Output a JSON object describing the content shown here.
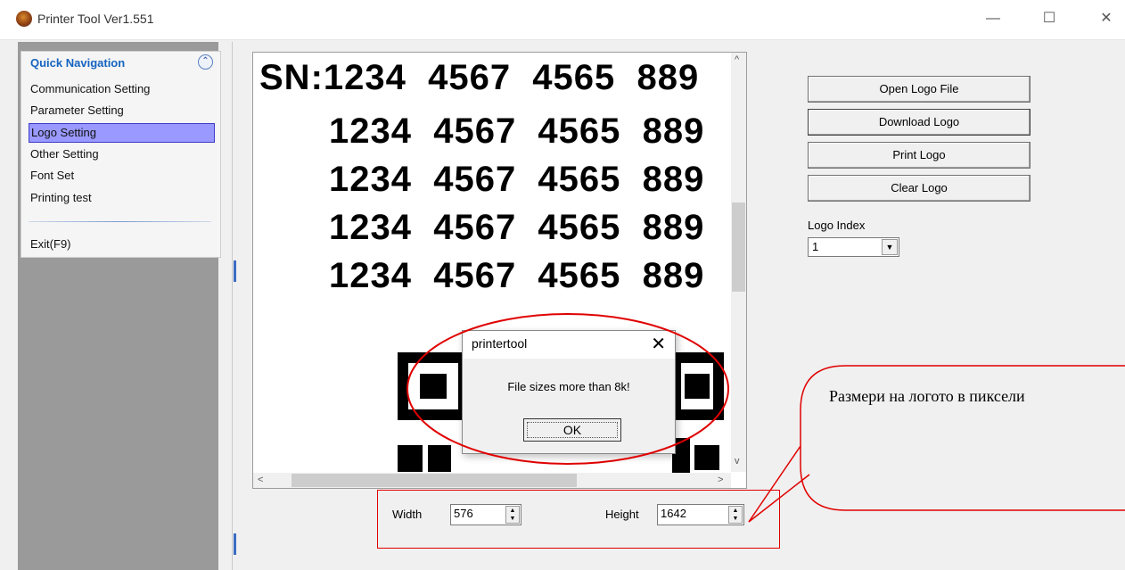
{
  "window": {
    "title": "Printer Tool Ver1.551",
    "minimize": "—",
    "maximize": "☐",
    "close": "✕"
  },
  "nav": {
    "header": "Quick Navigation",
    "collapse": "⌃",
    "items": [
      "Communication Setting",
      "Parameter Setting",
      "Logo Setting",
      "Other Setting",
      "Font Set",
      "Printing test"
    ],
    "exit": "Exit(F9)",
    "selected": "Logo Setting"
  },
  "preview": {
    "lines": [
      "SN:1234  4567  4565  889",
      "1234  4567  4565  889",
      "1234  4567  4565  889",
      "1234  4567  4565  889",
      "1234  4567  4565  889"
    ]
  },
  "buttons": {
    "open": "Open Logo File",
    "download": "Download Logo",
    "print": "Print Logo",
    "clear": "Clear Logo"
  },
  "logo_index": {
    "label": "Logo Index",
    "value": "1"
  },
  "size": {
    "width_label": "Width",
    "width_value": "576",
    "height_label": "Height",
    "height_value": "1642"
  },
  "dialog": {
    "title": "printertool",
    "close": "✕",
    "message": "File sizes more than 8k!",
    "ok": "OK"
  },
  "annotation": {
    "callout_text": "Размери на логото в пиксели",
    "color": "#e00000"
  }
}
